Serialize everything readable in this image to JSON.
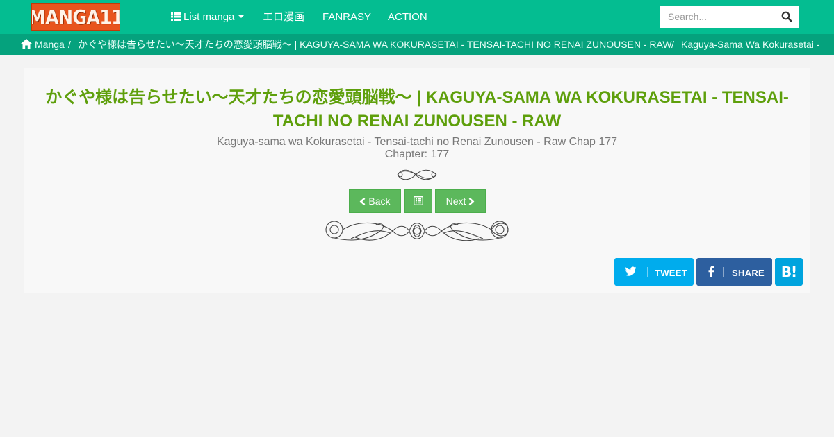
{
  "logo": {
    "text": "MANGA11"
  },
  "nav": {
    "list_manga": "List manga",
    "ero": "エロ漫画",
    "fanrasy": "FANRASY",
    "action": "ACTION"
  },
  "search": {
    "placeholder": "Search..."
  },
  "breadcrumb": {
    "items": [
      "Manga",
      "かぐや様は告らせたい～天才たちの恋愛頭脳戦～ | KAGUYA-SAMA WA KOKURASETAI - TENSAI-TACHI NO RENAI ZUNOUSEN - RAW",
      "Kaguya-Sama Wa Kokurasetai -"
    ],
    "separator": "/"
  },
  "content": {
    "title": "かぐや様は告らせたい～天才たちの恋愛頭脳戦～ | KAGUYA-SAMA WA KOKURASETAI - TENSAI-TACHI NO RENAI ZUNOUSEN - RAW",
    "subtitle": "Kaguya-sama wa Kokurasetai - Tensai-tachi no Renai Zunousen - Raw Chap 177",
    "chapter": "Chapter: 177"
  },
  "chapter_nav": {
    "back_label": "Back",
    "next_label": "Next"
  },
  "share": {
    "tweet_label": "TWEET",
    "share_label": "SHARE",
    "hatena_label": "B!"
  },
  "colors": {
    "navbar": "#04bd91",
    "breadcrumb": "#05a27d",
    "title": "#5e9f0b",
    "button": "#5cb85c",
    "twitter": "#00aced",
    "facebook": "#2d5f9f",
    "hatena": "#00a4de"
  },
  "icons": [
    "list-icon",
    "caret-down-icon",
    "search-icon",
    "home-icon",
    "chevron-left-icon",
    "list-alt-icon",
    "chevron-right-icon",
    "twitter-icon",
    "facebook-icon",
    "hatena-bookmark-icon",
    "flourish-divider"
  ]
}
